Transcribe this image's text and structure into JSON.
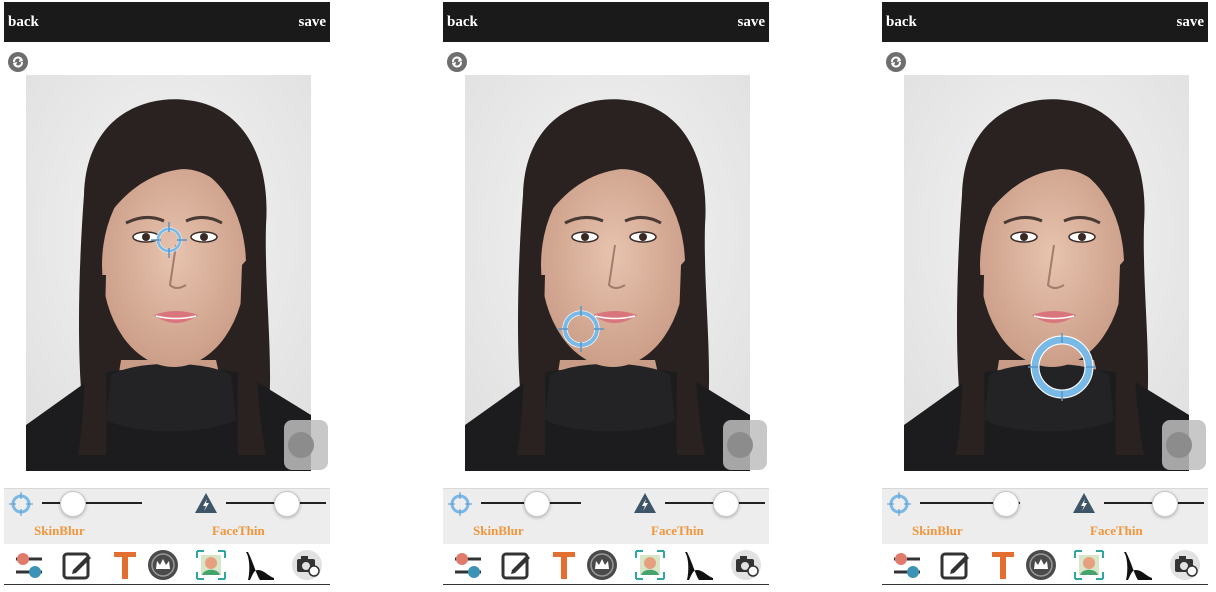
{
  "panels": [
    {
      "topbar": {
        "back_label": "back",
        "save_label": "save"
      },
      "sliders": {
        "skin_blur": {
          "label": "SkinBlur",
          "value": 0.3
        },
        "face_thin": {
          "label": "FaceThin",
          "value": 0.6
        }
      },
      "target_icon": "crosshair-target"
    },
    {
      "topbar": {
        "back_label": "back",
        "save_label": "save"
      },
      "sliders": {
        "skin_blur": {
          "label": "SkinBlur",
          "value": 0.55
        },
        "face_thin": {
          "label": "FaceThin",
          "value": 0.6
        }
      },
      "target_icon": "crosshair-target"
    },
    {
      "topbar": {
        "back_label": "back",
        "save_label": "save"
      },
      "sliders": {
        "skin_blur": {
          "label": "SkinBlur",
          "value": 0.85
        },
        "face_thin": {
          "label": "FaceThin",
          "value": 0.6
        }
      },
      "target_icon": "crosshair-target"
    }
  ],
  "toolbar_icons": [
    "adjust-sliders-icon",
    "edit-icon",
    "text-icon",
    "crown-badge-icon",
    "face-detect-icon",
    "high-heel-icon",
    "camera-icon"
  ],
  "colors": {
    "topbar": "#1a1a1a",
    "label_orange": "#f0963c",
    "crosshair_blue": "#79b9e8",
    "slider_bg": "#ededed"
  }
}
